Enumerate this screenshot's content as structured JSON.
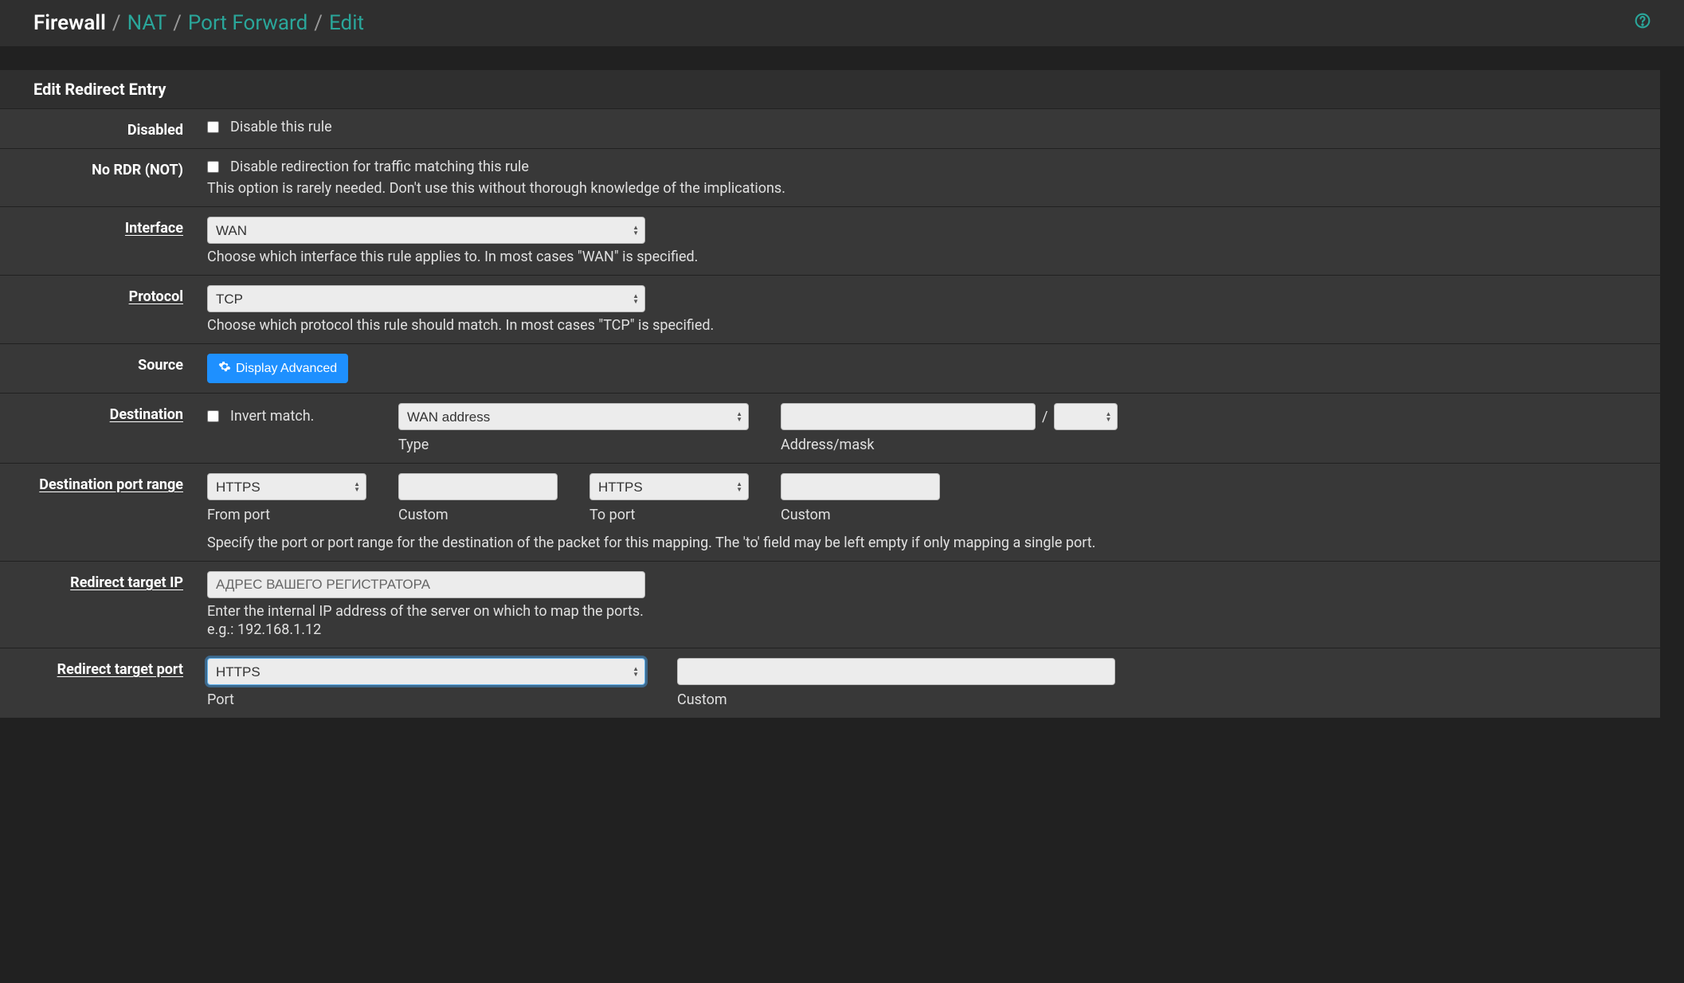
{
  "breadcrumb": {
    "first": "Firewall",
    "items": [
      "NAT",
      "Port Forward",
      "Edit"
    ]
  },
  "help_icon": "?",
  "panel": {
    "title": "Edit Redirect Entry"
  },
  "rows": {
    "disabled": {
      "label": "Disabled",
      "text": "Disable this rule"
    },
    "nordr": {
      "label": "No RDR (NOT)",
      "text": "Disable redirection for traffic matching this rule",
      "help": "This option is rarely needed. Don't use this without thorough knowledge of the implications."
    },
    "interface": {
      "label": "Interface",
      "value": "WAN",
      "help": "Choose which interface this rule applies to. In most cases \"WAN\" is specified."
    },
    "protocol": {
      "label": "Protocol",
      "value": "TCP",
      "help": "Choose which protocol this rule should match. In most cases \"TCP\" is specified."
    },
    "source": {
      "label": "Source",
      "button": "Display Advanced"
    },
    "destination": {
      "label": "Destination",
      "invert": "Invert match.",
      "type_value": "WAN address",
      "type_label": "Type",
      "address_label": "Address/mask",
      "slash": "/"
    },
    "dest_port_range": {
      "label": "Destination port range",
      "from_value": "HTTPS",
      "from_label": "From port",
      "custom1_label": "Custom",
      "to_value": "HTTPS",
      "to_label": "To port",
      "custom2_label": "Custom",
      "help": "Specify the port or port range for the destination of the packet for this mapping. The 'to' field may be left empty if only mapping a single port."
    },
    "redirect_ip": {
      "label": "Redirect target IP",
      "placeholder": "АДРЕС ВАШЕГО РЕГИСТРАТОРА",
      "help1": "Enter the internal IP address of the server on which to map the ports.",
      "help2": "e.g.: 192.168.1.12"
    },
    "redirect_port": {
      "label": "Redirect target port",
      "value": "HTTPS",
      "port_label": "Port",
      "custom_label": "Custom"
    }
  }
}
